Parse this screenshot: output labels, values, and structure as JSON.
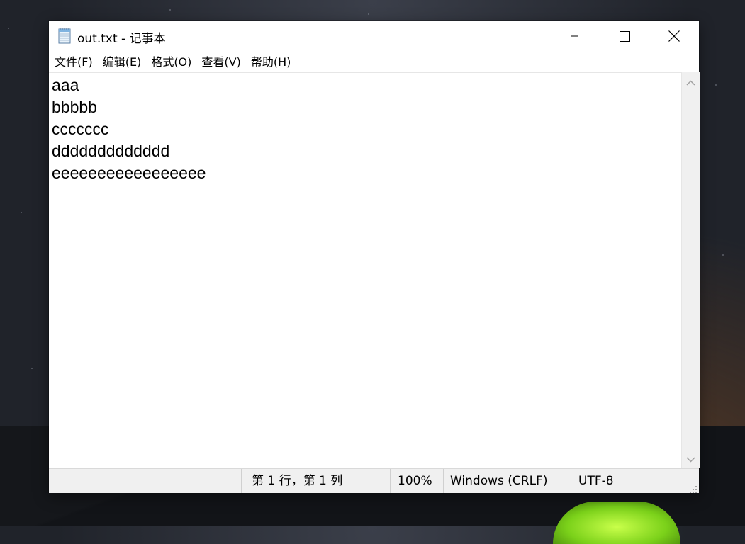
{
  "window": {
    "title": "out.txt - 记事本"
  },
  "menu": {
    "items": [
      "文件(F)",
      "编辑(E)",
      "格式(O)",
      "查看(V)",
      "帮助(H)"
    ]
  },
  "editor": {
    "lines": [
      "aaa",
      "bbbbb",
      "ccccccc",
      "ddddddddddddd",
      "eeeeeeeeeeeeeeeee"
    ]
  },
  "status": {
    "position": "第 1 行，第 1 列",
    "zoom": "100%",
    "line_ending": "Windows (CRLF)",
    "encoding": "UTF-8"
  },
  "icons": {
    "app": "notepad-icon",
    "minimize": "minimize-icon",
    "maximize": "maximize-icon",
    "close": "close-icon",
    "scroll_up": "chevron-up-icon",
    "scroll_down": "chevron-down-icon",
    "grip": "resize-grip-icon"
  }
}
